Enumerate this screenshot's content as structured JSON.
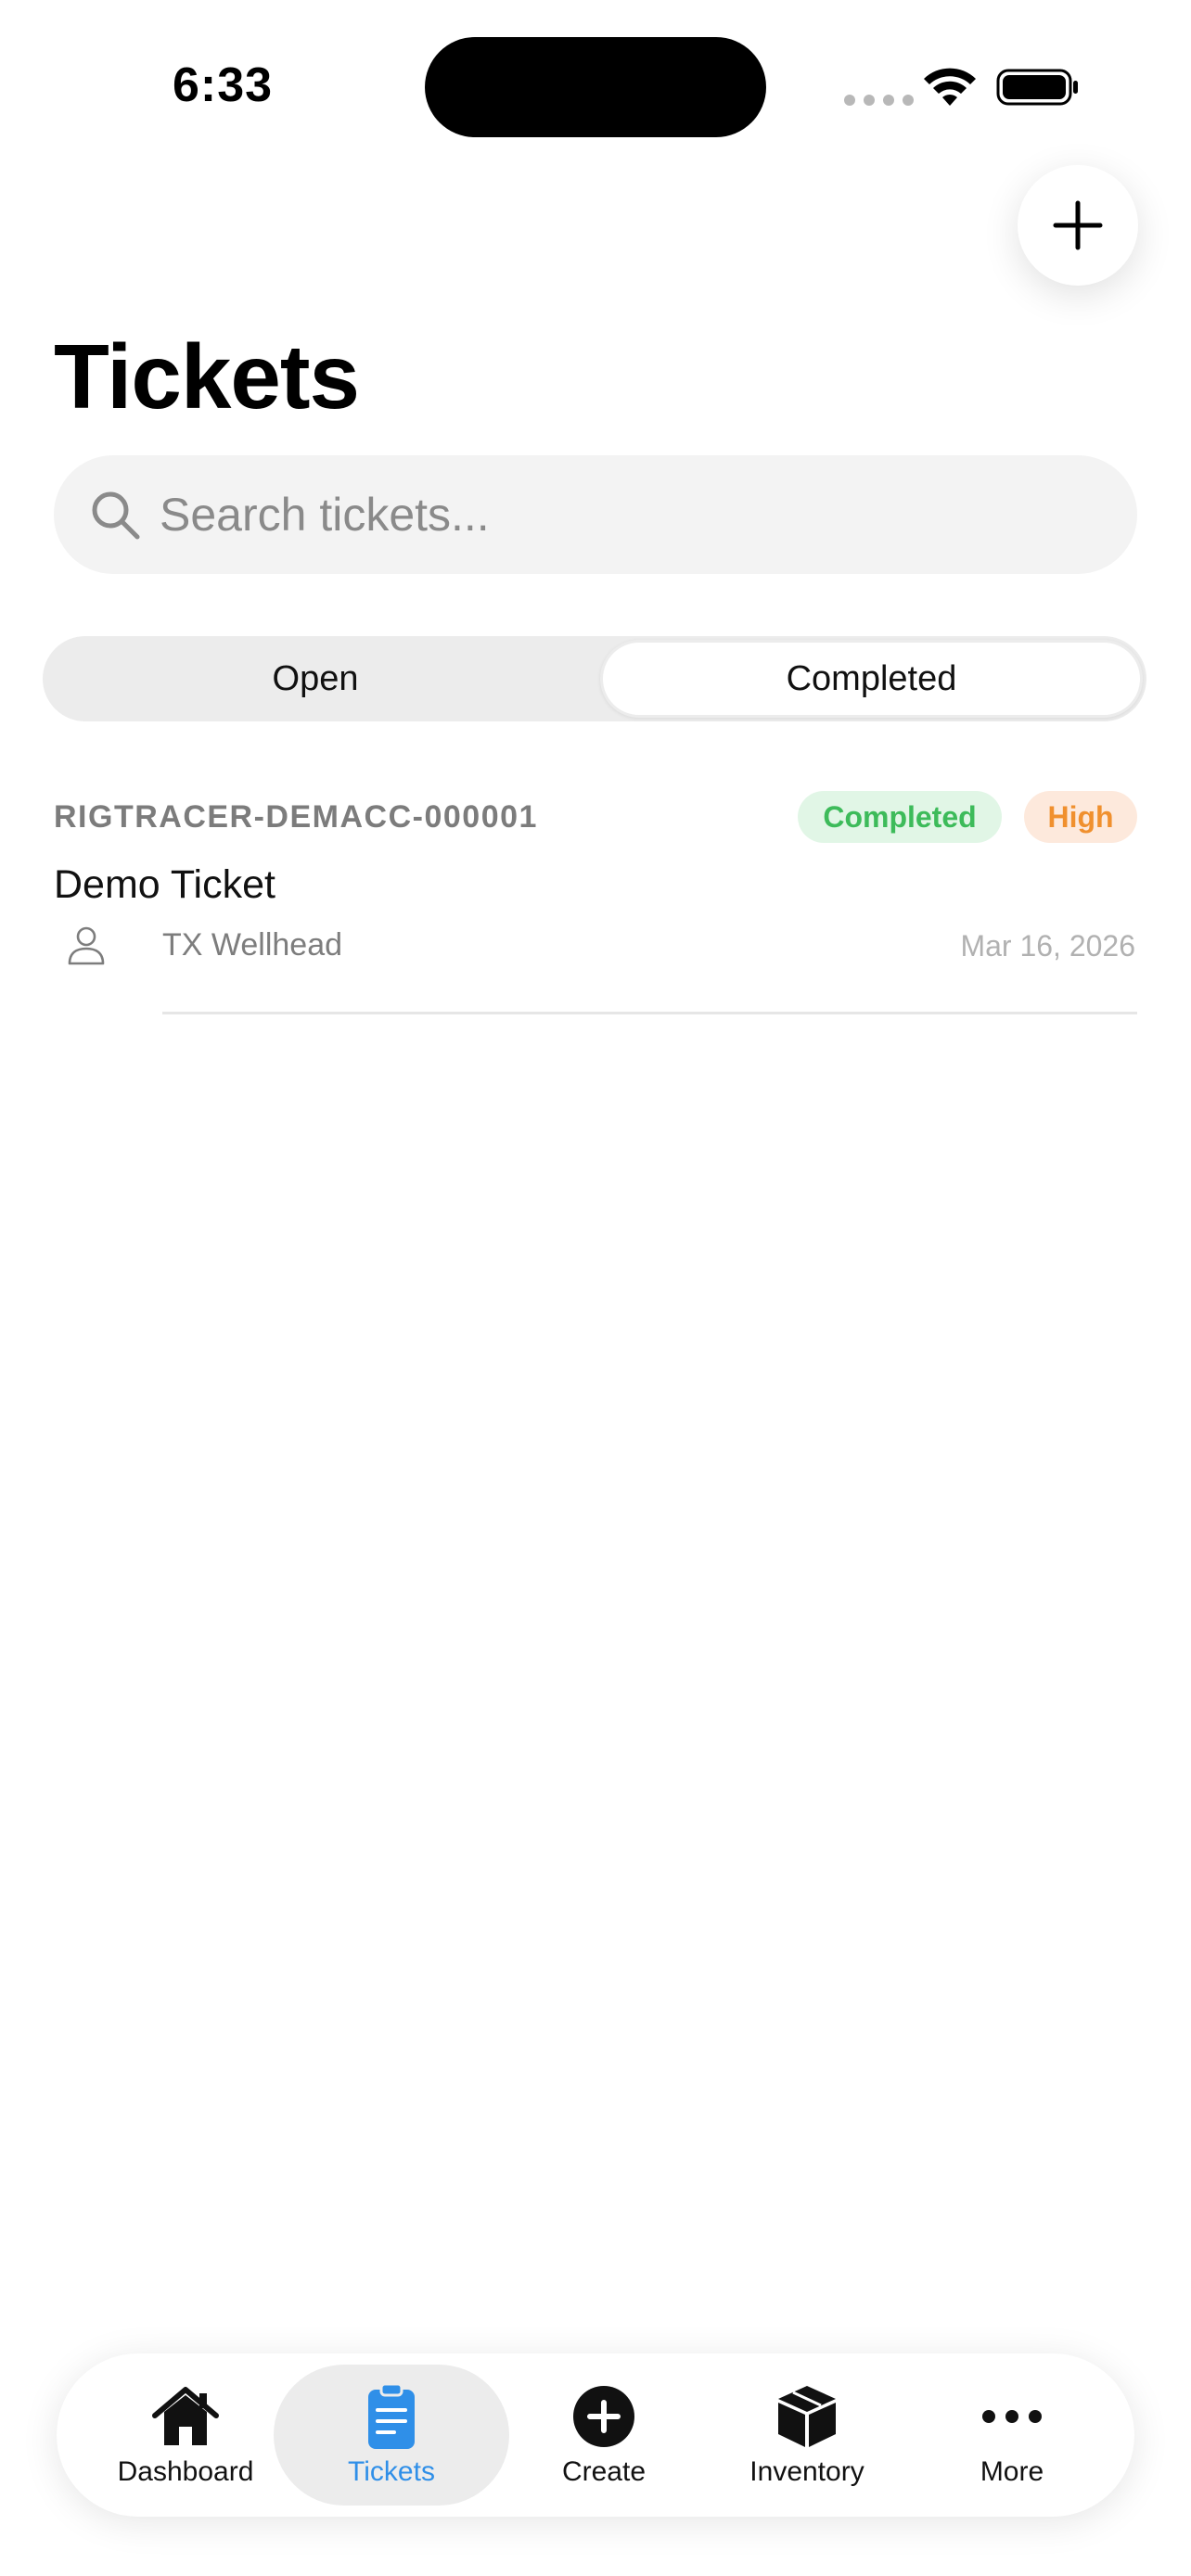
{
  "status_bar": {
    "time": "6:33"
  },
  "header": {
    "title": "Tickets",
    "add_button_icon": "plus-icon"
  },
  "search": {
    "placeholder": "Search tickets...",
    "value": ""
  },
  "segments": {
    "open_label": "Open",
    "completed_label": "Completed",
    "selected": "Completed"
  },
  "tickets": [
    {
      "id": "RIGTRACER-DEMACC-000001",
      "status": "Completed",
      "priority": "High",
      "title": "Demo Ticket",
      "location": "TX Wellhead",
      "date": "Mar 16, 2026"
    }
  ],
  "tabbar": {
    "items": [
      {
        "label": "Dashboard",
        "icon": "house-icon"
      },
      {
        "label": "Tickets",
        "icon": "clipboard-icon",
        "active": true
      },
      {
        "label": "Create",
        "icon": "plus-circle-icon"
      },
      {
        "label": "Inventory",
        "icon": "box-icon"
      },
      {
        "label": "More",
        "icon": "ellipsis-icon"
      }
    ]
  },
  "colors": {
    "accent": "#2f8fe8",
    "completed_badge_bg": "#e1f6e6",
    "completed_badge_text": "#3dbb5a",
    "priority_badge_bg": "#fde9dc",
    "priority_badge_text": "#f0902e"
  }
}
